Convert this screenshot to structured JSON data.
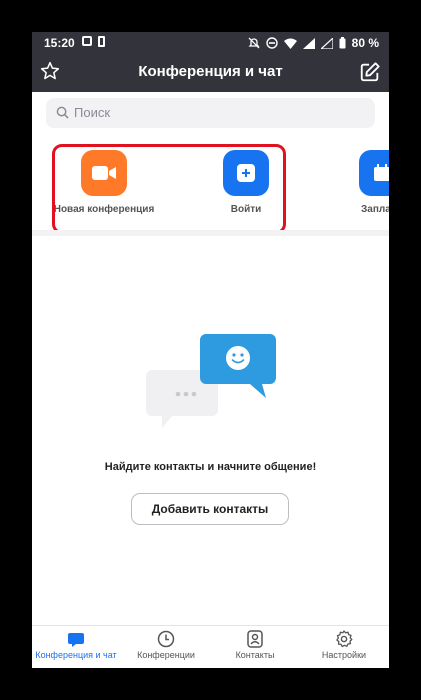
{
  "status_bar": {
    "time": "15:20",
    "battery": "80 %"
  },
  "header": {
    "title": "Конференция и чат"
  },
  "search": {
    "placeholder": "Поиск"
  },
  "actions": [
    {
      "label": "Новая конференция",
      "color": "#ff7a28"
    },
    {
      "label": "Войти",
      "color": "#1873f0"
    },
    {
      "label": "Заплани",
      "color": "#1873f0"
    }
  ],
  "empty_state": {
    "message": "Найдите контакты и начните общение!",
    "button_label": "Добавить контакты"
  },
  "tabs": [
    {
      "label": "Конференция и чат",
      "icon": "chat-bubble-icon",
      "active": true
    },
    {
      "label": "Конференции",
      "icon": "clock-icon",
      "active": false
    },
    {
      "label": "Контакты",
      "icon": "contact-card-icon",
      "active": false
    },
    {
      "label": "Настройки",
      "icon": "gear-icon",
      "active": false
    }
  ],
  "colors": {
    "header_bg": "#33333c",
    "accent": "#1873f0",
    "highlight": "#e0121f"
  }
}
